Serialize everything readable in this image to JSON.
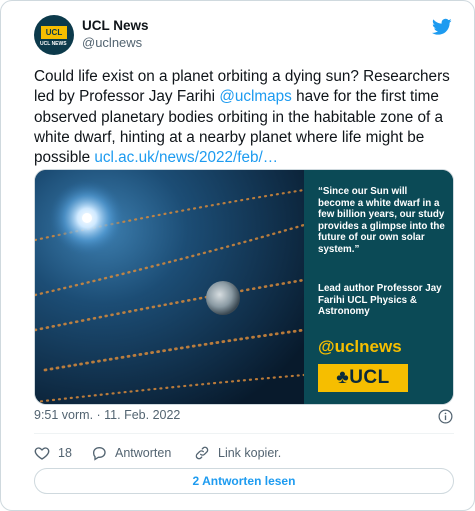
{
  "account": {
    "name": "UCL News",
    "handle": "@uclnews",
    "avatar_badge": "UCL",
    "avatar_sub": "UCL NEWS"
  },
  "tweet": {
    "text_before": "Could life exist on a planet orbiting a dying sun? Researchers led by Professor Jay Farihi ",
    "mention": "@uclmaps",
    "text_after": " have for the first time observed planetary bodies orbiting in the habitable zone of a white dwarf, hinting at a nearby planet where life might be possible ",
    "link": "ucl.ac.uk/news/2022/feb/…"
  },
  "media": {
    "quote": "“Since our Sun will become a white dwarf in a few billion years, our study provides a glimpse into the future of our own solar system.”",
    "attribution": "Lead author Professor Jay Farihi UCL Physics & Astronomy",
    "brand_handle": "@uclnews",
    "logo_text": "♣UCL"
  },
  "meta": {
    "timestamp": "9:51 vorm. · 11. Feb. 2022"
  },
  "actions": {
    "like_count": "18",
    "reply_label": "Antworten",
    "copy_link_label": "Link kopier."
  },
  "read_replies_label": "2 Antworten lesen",
  "colors": {
    "accent": "#1d9bf0",
    "ucl_yellow": "#f6be00",
    "ucl_teal": "#0b4a56"
  },
  "icons": [
    "twitter-bird-icon",
    "info-icon",
    "heart-icon",
    "reply-bubble-icon",
    "link-icon"
  ]
}
